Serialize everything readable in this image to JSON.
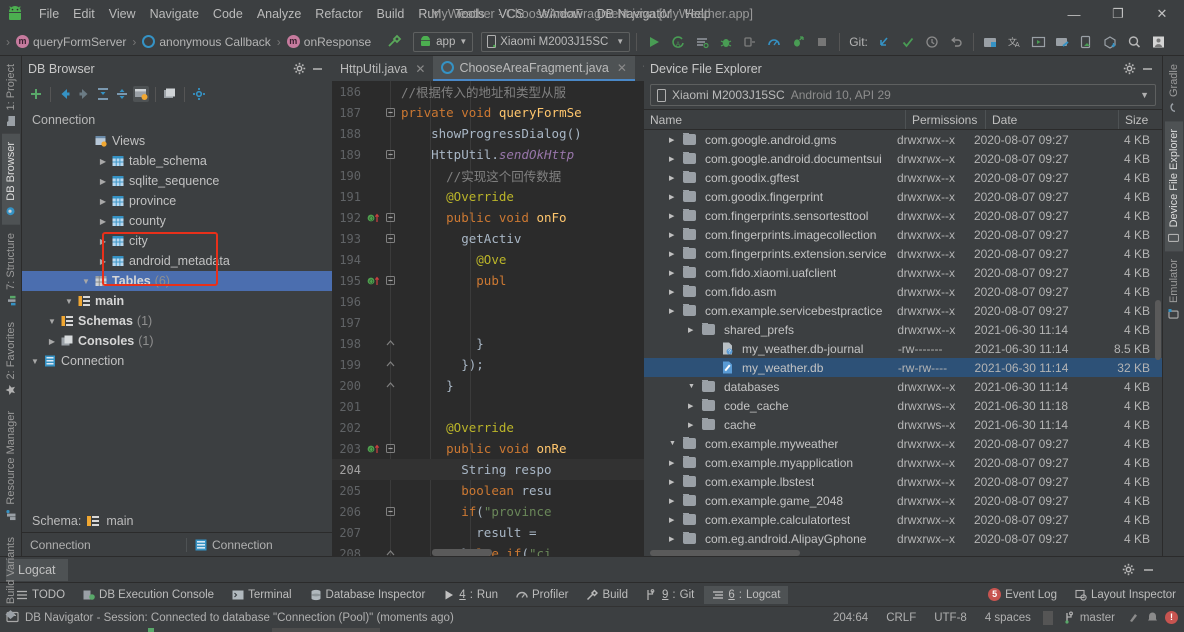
{
  "window": {
    "title": "MyWeather - ChooseAreaFragment.java [MyWeather.app]",
    "minimize": "—",
    "maximize": "❐",
    "close": "✕"
  },
  "menubar": {
    "logo": "android-logo-icon",
    "items": [
      "File",
      "Edit",
      "View",
      "Navigate",
      "Code",
      "Analyze",
      "Refactor",
      "Build",
      "Run",
      "Tools",
      "VCS",
      "Window",
      "DB Navigator",
      "Help"
    ]
  },
  "toolbar": {
    "breadcrumbs": [
      {
        "label": "queryFormServer",
        "icon": "method-icon"
      },
      {
        "label": "anonymous Callback",
        "icon": "class-icon"
      },
      {
        "label": "onResponse",
        "icon": "method-icon"
      }
    ],
    "build_icon": "hammer-icon",
    "module_combo": "app",
    "device_combo": "Xiaomi M2003J15SC",
    "run_icons": [
      "run-icon",
      "run-coverage-icon",
      "profile-icon",
      "debug-icon",
      "attach-debugger-icon",
      "profiler-icon",
      "apply-changes-icon",
      "stop-icon"
    ],
    "git_label": "Git:",
    "git_icons": [
      "update-project-icon",
      "commit-icon",
      "history-icon",
      "rollback-icon"
    ],
    "right_icons": [
      "sdk-manager-icon",
      "avd-manager-icon",
      "layout-inspector-icon",
      "device-manager-icon",
      "device-file-explorer-icon",
      "sync-gradle-icon",
      "search-icon",
      "profile-avatar-icon"
    ]
  },
  "left_stripe": {
    "items": [
      {
        "label": "1: Project",
        "icon": "project-icon",
        "active": false
      },
      {
        "label": "DB Browser",
        "icon": "db-browser-icon",
        "active": true
      },
      {
        "label": "7: Structure",
        "icon": "structure-icon",
        "active": false
      },
      {
        "label": "2: Favorites",
        "icon": "star-icon",
        "active": false
      },
      {
        "label": "Resource Manager",
        "icon": "resource-manager-icon",
        "active": false
      },
      {
        "label": "Build Variants",
        "icon": "build-variants-icon",
        "active": false
      }
    ]
  },
  "right_stripe": {
    "items": [
      {
        "label": "Gradle",
        "icon": "gradle-icon",
        "active": false
      },
      {
        "label": "Device File Explorer",
        "icon": "device-file-explorer-icon",
        "active": true
      },
      {
        "label": "Emulator",
        "icon": "emulator-icon",
        "active": false
      }
    ]
  },
  "db_browser": {
    "title": "DB Browser",
    "header_icons": [
      "gear-icon",
      "minimize-icon"
    ],
    "toolbar_icons": [
      "add-icon",
      "back-icon",
      "forward-icon",
      "expand-all-icon",
      "collapse-all-icon",
      "show-data-icon",
      "open-console-icon",
      "settings-icon"
    ],
    "connection_label": "Connection",
    "tree": [
      {
        "label": "Connection",
        "depth": 0,
        "arrow": "▼",
        "icon": "connection-icon",
        "bold": false,
        "count": ""
      },
      {
        "label": "Consoles",
        "depth": 1,
        "arrow": "▶",
        "icon": "consoles-icon",
        "bold": true,
        "count": "(1)"
      },
      {
        "label": "Schemas",
        "depth": 1,
        "arrow": "▼",
        "icon": "schemas-icon",
        "bold": true,
        "count": "(1)"
      },
      {
        "label": "main",
        "depth": 2,
        "arrow": "▼",
        "icon": "schema-icon",
        "bold": true,
        "count": ""
      },
      {
        "label": "Tables",
        "depth": 3,
        "arrow": "▼",
        "icon": "tables-icon",
        "bold": true,
        "count": "(6)",
        "selected": true
      },
      {
        "label": "android_metadata",
        "depth": 4,
        "arrow": "▶",
        "icon": "table-icon",
        "bold": false,
        "count": ""
      },
      {
        "label": "city",
        "depth": 4,
        "arrow": "▶",
        "icon": "table-icon",
        "bold": false,
        "count": ""
      },
      {
        "label": "county",
        "depth": 4,
        "arrow": "▶",
        "icon": "table-icon",
        "bold": false,
        "count": ""
      },
      {
        "label": "province",
        "depth": 4,
        "arrow": "▶",
        "icon": "table-icon",
        "bold": false,
        "count": ""
      },
      {
        "label": "sqlite_sequence",
        "depth": 4,
        "arrow": "▶",
        "icon": "table-icon",
        "bold": false,
        "count": ""
      },
      {
        "label": "table_schema",
        "depth": 4,
        "arrow": "▶",
        "icon": "table-icon",
        "bold": false,
        "count": ""
      },
      {
        "label": "Views",
        "depth": 3,
        "arrow": "",
        "icon": "views-icon",
        "bold": false,
        "count": ""
      }
    ],
    "annotation_color": "#e8301a",
    "schema_label": "Schema:",
    "schema_value": "main",
    "footer_left": "Connection",
    "footer_right": "Connection"
  },
  "editor": {
    "tabs": [
      {
        "label": "HttpUtil.java",
        "active": false,
        "icon": ""
      },
      {
        "label": "ChooseAreaFragment.java",
        "active": true,
        "icon": "class-icon"
      }
    ],
    "current_line": 204,
    "lines": [
      {
        "n": "186",
        "marker": "",
        "fold": "",
        "html": "<span class='cm'>//根据传入的地址和类型从服</span>"
      },
      {
        "n": "187",
        "marker": "",
        "fold": "−",
        "html": "<span class='kw'>private</span> <span class='kw'>void</span> <span class='fn'>queryFormSe</span>"
      },
      {
        "n": "188",
        "marker": "",
        "fold": "",
        "html": "    <span class='pl'>showProgressDialog(</span><span class='pl'>)</span>"
      },
      {
        "n": "189",
        "marker": "",
        "fold": "−",
        "html": "    <span class='pl'>HttpUtil.</span><span class='it'>sendOkHttp</span>"
      },
      {
        "n": "190",
        "marker": "",
        "fold": "",
        "html": "      <span class='cm'>//实现这个回传数据</span>"
      },
      {
        "n": "191",
        "marker": "",
        "fold": "",
        "html": "      <span class='an'>@Override</span>"
      },
      {
        "n": "192",
        "marker": "override",
        "fold": "−",
        "html": "      <span class='kw'>public</span> <span class='kw'>void</span> <span class='fn'>onFo</span>"
      },
      {
        "n": "193",
        "marker": "",
        "fold": "−",
        "html": "        <span class='pl'>getActiv</span>"
      },
      {
        "n": "194",
        "marker": "",
        "fold": "",
        "html": "          <span class='an'>@Ove</span>"
      },
      {
        "n": "195",
        "marker": "override",
        "fold": "−",
        "html": "          <span class='kw'>publ</span>"
      },
      {
        "n": "196",
        "marker": "",
        "fold": "",
        "html": ""
      },
      {
        "n": "197",
        "marker": "",
        "fold": "",
        "html": ""
      },
      {
        "n": "198",
        "marker": "",
        "fold": "⌃",
        "html": "          <span class='pl'>}</span>"
      },
      {
        "n": "199",
        "marker": "",
        "fold": "⌃",
        "html": "        <span class='pl'>});</span>"
      },
      {
        "n": "200",
        "marker": "",
        "fold": "⌃",
        "html": "      <span class='pl'>}</span>"
      },
      {
        "n": "201",
        "marker": "",
        "fold": "",
        "html": ""
      },
      {
        "n": "202",
        "marker": "",
        "fold": "",
        "html": "      <span class='an'>@Override</span>"
      },
      {
        "n": "203",
        "marker": "override",
        "fold": "−",
        "html": "      <span class='kw'>public</span> <span class='kw'>void</span> <span class='fn'>onRe</span>"
      },
      {
        "n": "204",
        "marker": "",
        "fold": "",
        "html": "        <span class='pl'>String</span> <span class='pl'>respo</span>",
        "current": true
      },
      {
        "n": "205",
        "marker": "",
        "fold": "",
        "html": "        <span class='kw'>boolean</span> <span class='pl'>resu</span>"
      },
      {
        "n": "206",
        "marker": "",
        "fold": "−",
        "html": "        <span class='kw'>if</span><span class='pl'>(</span><span class='st'>\"province</span>"
      },
      {
        "n": "207",
        "marker": "",
        "fold": "",
        "html": "          <span class='pl'>result =</span>"
      },
      {
        "n": "208",
        "marker": "",
        "fold": "⌃",
        "html": "        <span class='pl'>}</span><span class='kw'>else if</span><span class='pl'>(</span><span class='st'>\"ci</span>"
      }
    ]
  },
  "device_file_explorer": {
    "title": "Device File Explorer",
    "header_icons": [
      "gear-icon",
      "minimize-icon"
    ],
    "device": {
      "name": "Xiaomi M2003J15SC",
      "info": "Android 10, API 29",
      "icon": "phone-icon"
    },
    "columns": [
      "Name",
      "Permissions",
      "Date",
      "Size"
    ],
    "rows": [
      {
        "name": "com.eg.android.AlipayGphone",
        "depth": 1,
        "arrow": "▶",
        "icon": "folder-icon",
        "permissions": "drwxrwx--x",
        "date": "2020-08-07 09:27",
        "size": "4 KB"
      },
      {
        "name": "com.example.calculatortest",
        "depth": 1,
        "arrow": "▶",
        "icon": "folder-icon",
        "permissions": "drwxrwx--x",
        "date": "2020-08-07 09:27",
        "size": "4 KB"
      },
      {
        "name": "com.example.game_2048",
        "depth": 1,
        "arrow": "▶",
        "icon": "folder-icon",
        "permissions": "drwxrwx--x",
        "date": "2020-08-07 09:27",
        "size": "4 KB"
      },
      {
        "name": "com.example.lbstest",
        "depth": 1,
        "arrow": "▶",
        "icon": "folder-icon",
        "permissions": "drwxrwx--x",
        "date": "2020-08-07 09:27",
        "size": "4 KB"
      },
      {
        "name": "com.example.myapplication",
        "depth": 1,
        "arrow": "▶",
        "icon": "folder-icon",
        "permissions": "drwxrwx--x",
        "date": "2020-08-07 09:27",
        "size": "4 KB"
      },
      {
        "name": "com.example.myweather",
        "depth": 1,
        "arrow": "▼",
        "icon": "folder-icon",
        "permissions": "drwxrwx--x",
        "date": "2020-08-07 09:27",
        "size": "4 KB"
      },
      {
        "name": "cache",
        "depth": 2,
        "arrow": "▶",
        "icon": "folder-icon",
        "permissions": "drwxrws--x",
        "date": "2021-06-30 11:14",
        "size": "4 KB"
      },
      {
        "name": "code_cache",
        "depth": 2,
        "arrow": "▶",
        "icon": "folder-icon",
        "permissions": "drwxrws--x",
        "date": "2021-06-30 11:18",
        "size": "4 KB"
      },
      {
        "name": "databases",
        "depth": 2,
        "arrow": "▼",
        "icon": "folder-icon",
        "permissions": "drwxrwx--x",
        "date": "2021-06-30 11:14",
        "size": "4 KB"
      },
      {
        "name": "my_weather.db",
        "depth": 3,
        "arrow": "",
        "icon": "db-file-icon",
        "permissions": "-rw-rw----",
        "date": "2021-06-30 11:14",
        "size": "32 KB",
        "selected": true
      },
      {
        "name": "my_weather.db-journal",
        "depth": 3,
        "arrow": "",
        "icon": "unknown-file-icon",
        "permissions": "-rw-------",
        "date": "2021-06-30 11:14",
        "size": "8.5 KB"
      },
      {
        "name": "shared_prefs",
        "depth": 2,
        "arrow": "▶",
        "icon": "folder-icon",
        "permissions": "drwxrwx--x",
        "date": "2021-06-30 11:14",
        "size": "4 KB"
      },
      {
        "name": "com.example.servicebestpractice",
        "depth": 1,
        "arrow": "▶",
        "icon": "folder-icon",
        "permissions": "drwxrwx--x",
        "date": "2020-08-07 09:27",
        "size": "4 KB"
      },
      {
        "name": "com.fido.asm",
        "depth": 1,
        "arrow": "▶",
        "icon": "folder-icon",
        "permissions": "drwxrwx--x",
        "date": "2020-08-07 09:27",
        "size": "4 KB"
      },
      {
        "name": "com.fido.xiaomi.uafclient",
        "depth": 1,
        "arrow": "▶",
        "icon": "folder-icon",
        "permissions": "drwxrwx--x",
        "date": "2020-08-07 09:27",
        "size": "4 KB"
      },
      {
        "name": "com.fingerprints.extension.service",
        "depth": 1,
        "arrow": "▶",
        "icon": "folder-icon",
        "permissions": "drwxrwx--x",
        "date": "2020-08-07 09:27",
        "size": "4 KB"
      },
      {
        "name": "com.fingerprints.imagecollection",
        "depth": 1,
        "arrow": "▶",
        "icon": "folder-icon",
        "permissions": "drwxrwx--x",
        "date": "2020-08-07 09:27",
        "size": "4 KB"
      },
      {
        "name": "com.fingerprints.sensortesttool",
        "depth": 1,
        "arrow": "▶",
        "icon": "folder-icon",
        "permissions": "drwxrwx--x",
        "date": "2020-08-07 09:27",
        "size": "4 KB"
      },
      {
        "name": "com.goodix.fingerprint",
        "depth": 1,
        "arrow": "▶",
        "icon": "folder-icon",
        "permissions": "drwxrwx--x",
        "date": "2020-08-07 09:27",
        "size": "4 KB"
      },
      {
        "name": "com.goodix.gftest",
        "depth": 1,
        "arrow": "▶",
        "icon": "folder-icon",
        "permissions": "drwxrwx--x",
        "date": "2020-08-07 09:27",
        "size": "4 KB"
      },
      {
        "name": "com.google.android.documentsui",
        "depth": 1,
        "arrow": "▶",
        "icon": "folder-icon",
        "permissions": "drwxrwx--x",
        "date": "2020-08-07 09:27",
        "size": "4 KB"
      },
      {
        "name": "com.google.android.gms",
        "depth": 1,
        "arrow": "▶",
        "icon": "folder-icon",
        "permissions": "drwxrwx--x",
        "date": "2020-08-07 09:27",
        "size": "4 KB"
      }
    ]
  },
  "logcat_panel": {
    "tab_label": "Logcat",
    "header_icons": [
      "gear-icon",
      "minimize-icon"
    ]
  },
  "bottom_tabs": {
    "left": [
      {
        "label": "TODO",
        "icon": "todo-icon",
        "active": false,
        "mnemonic": ""
      },
      {
        "label": "DB Execution Console",
        "icon": "db-console-icon",
        "active": false,
        "mnemonic": ""
      },
      {
        "label": "Terminal",
        "icon": "terminal-icon",
        "active": false,
        "mnemonic": ""
      },
      {
        "label": "Database Inspector",
        "icon": "database-inspector-icon",
        "active": false,
        "mnemonic": ""
      },
      {
        "label": "Run",
        "icon": "run-icon",
        "active": false,
        "mnemonic": "4"
      },
      {
        "label": "Profiler",
        "icon": "profiler-icon",
        "active": false,
        "mnemonic": ""
      },
      {
        "label": "Build",
        "icon": "hammer-icon",
        "active": false,
        "mnemonic": ""
      },
      {
        "label": "Git",
        "icon": "git-icon",
        "active": false,
        "mnemonic": "9"
      },
      {
        "label": "Logcat",
        "icon": "logcat-icon",
        "active": true,
        "mnemonic": "6"
      }
    ],
    "right": [
      {
        "label": "Event Log",
        "icon": "event-log-icon",
        "badge": "5"
      },
      {
        "label": "Layout Inspector",
        "icon": "layout-inspector-icon",
        "badge": ""
      }
    ]
  },
  "statusbar": {
    "message": "DB Navigator - Session: Connected to database \"Connection (Pool)\" (moments ago)",
    "message_icon": "balloon-icon",
    "caret": "204:64",
    "line_separator": "CRLF",
    "encoding": "UTF-8",
    "indent": "4 spaces",
    "branch": "master",
    "branch_icon": "git-branch-icon",
    "right_icons": [
      "inspection-icon",
      "notification-icon",
      "error-badge-icon"
    ]
  },
  "colors": {
    "panel_bg": "#3c3f41",
    "editor_bg": "#2b2b2b",
    "selection_blue": "#4b6eaf",
    "file_selection_blue": "#2d5177",
    "annotation_red": "#e8301a",
    "accent_green": "#499c54",
    "accent_blue": "#3592c4"
  }
}
